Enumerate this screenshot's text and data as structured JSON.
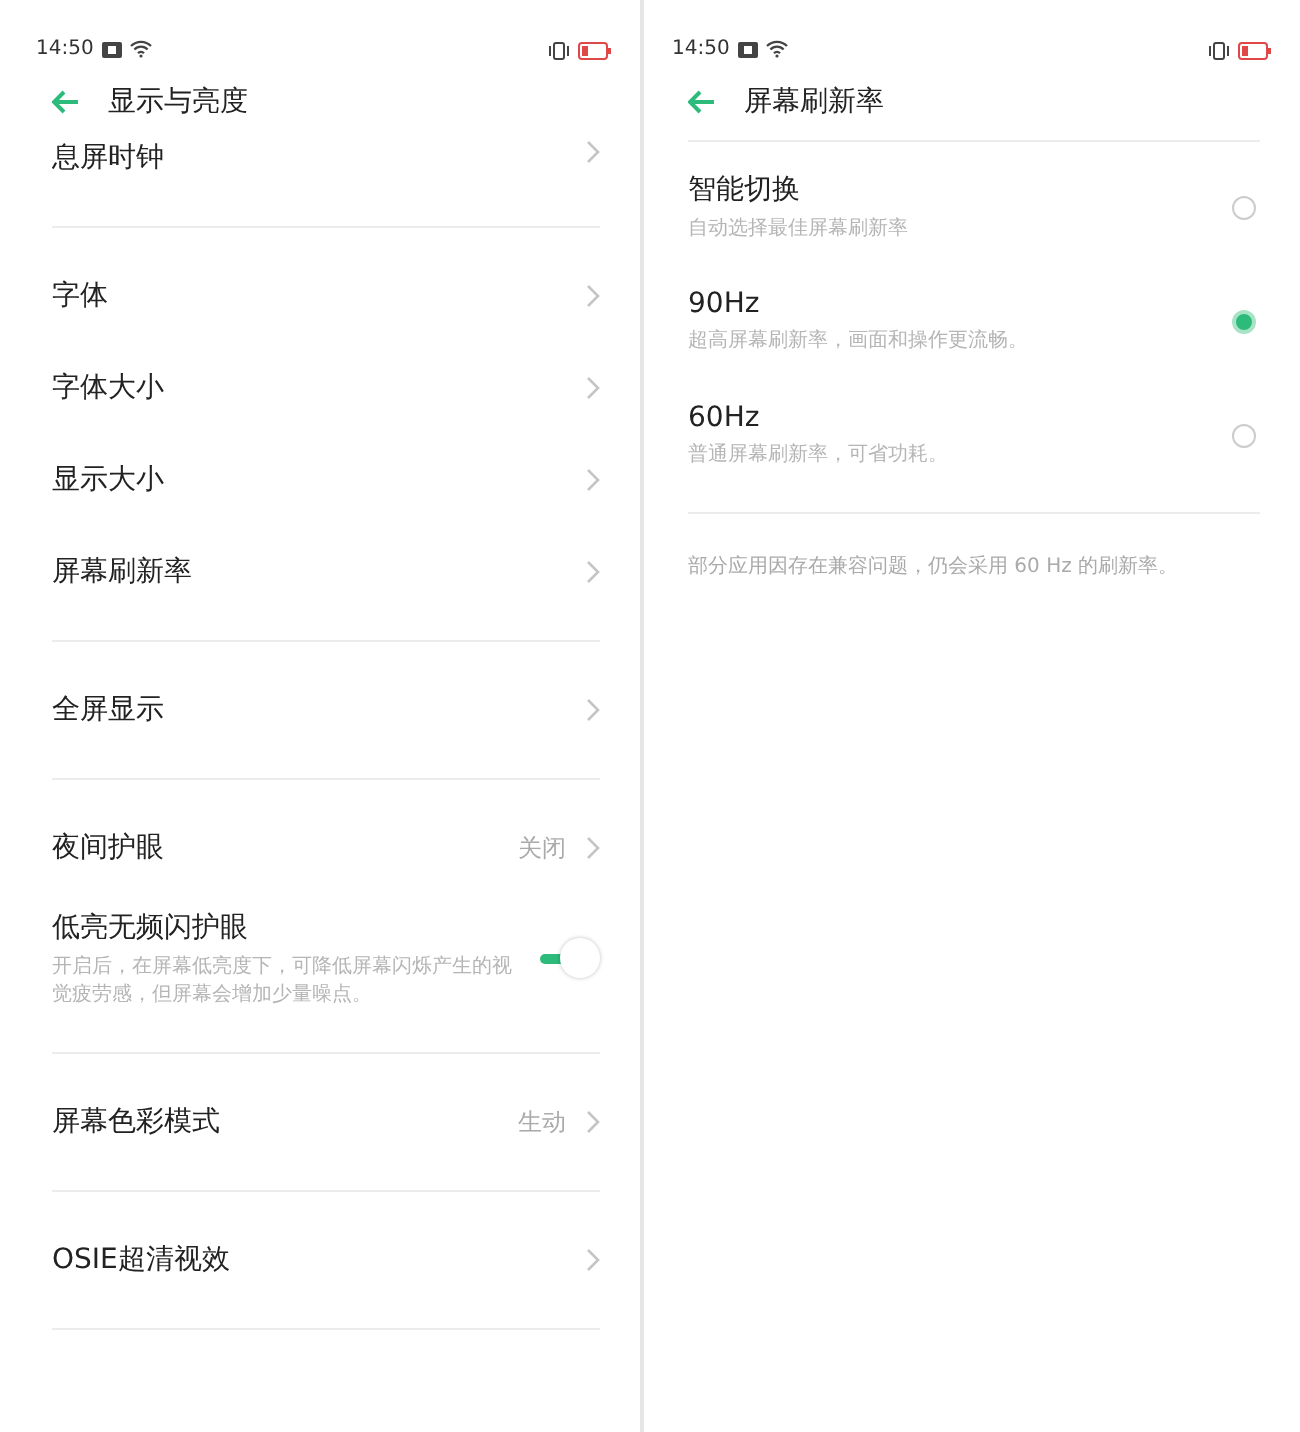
{
  "screens": [
    {
      "status_time": "14:50",
      "title": "显示与亮度",
      "groups": [
        [
          {
            "kind": "link",
            "label": "息屏时钟"
          }
        ],
        [
          {
            "kind": "link",
            "label": "字体"
          },
          {
            "kind": "link",
            "label": "字体大小"
          },
          {
            "kind": "link",
            "label": "显示大小"
          },
          {
            "kind": "link",
            "label": "屏幕刷新率"
          }
        ],
        [
          {
            "kind": "link",
            "label": "全屏显示"
          }
        ],
        [
          {
            "kind": "link",
            "label": "夜间护眼",
            "value": "关闭"
          },
          {
            "kind": "toggle",
            "label": "低亮无频闪护眼",
            "description": "开启后，在屏幕低亮度下，可降低屏幕闪烁产生的视觉疲劳感，但屏幕会增加少量噪点。",
            "on": true
          }
        ],
        [
          {
            "kind": "link",
            "label": "屏幕色彩模式",
            "value": "生动"
          }
        ],
        [
          {
            "kind": "link",
            "label": "OSIE超清视效"
          }
        ]
      ]
    },
    {
      "status_time": "14:50",
      "title": "屏幕刷新率",
      "options": [
        {
          "label": "智能切换",
          "description": "自动选择最佳屏幕刷新率",
          "selected": false
        },
        {
          "label": "90Hz",
          "description": "超高屏幕刷新率，画面和操作更流畅。",
          "selected": true
        },
        {
          "label": "60Hz",
          "description": "普通屏幕刷新率，可省功耗。",
          "selected": false
        }
      ],
      "note": "部分应用因存在兼容问题，仍会采用 60 Hz 的刷新率。"
    }
  ]
}
